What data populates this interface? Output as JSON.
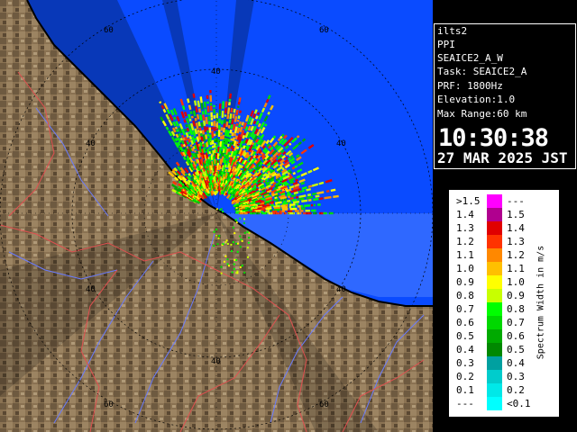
{
  "info": {
    "site": "ilts2",
    "mode": "PPI",
    "product": "SEAICE2_A_W",
    "task": "Task: SEAICE2_A",
    "prf": "PRF: 1800Hz",
    "elevation": "Elevation:1.0",
    "max_range": "Max Range:60 km",
    "time": "10:30:38",
    "date": "27 MAR 2025 JST"
  },
  "map": {
    "ring_labels": [
      "60",
      "60",
      "40",
      "40",
      "40",
      "40",
      "40",
      "40",
      "60",
      "60"
    ],
    "colors": {
      "sea": "#0a4bff",
      "sea_light": "#3a7dff",
      "land": "#8b7355",
      "shadow_sea": "#08308f"
    }
  },
  "legend": {
    "unit": "Spectrum Width in m/s",
    "rows": [
      {
        "left": ">1.5",
        "right": "---",
        "color": "#ff00ff"
      },
      {
        "left": "1.4",
        "right": "1.5",
        "color": "#b0008f"
      },
      {
        "left": "1.3",
        "right": "1.4",
        "color": "#e00000"
      },
      {
        "left": "1.2",
        "right": "1.3",
        "color": "#ff3300"
      },
      {
        "left": "1.1",
        "right": "1.2",
        "color": "#ff8800"
      },
      {
        "left": "1.0",
        "right": "1.1",
        "color": "#ffc000"
      },
      {
        "left": "0.9",
        "right": "1.0",
        "color": "#ffff00"
      },
      {
        "left": "0.8",
        "right": "0.9",
        "color": "#c8ff00"
      },
      {
        "left": "0.7",
        "right": "0.8",
        "color": "#00ff00"
      },
      {
        "left": "0.6",
        "right": "0.7",
        "color": "#00d800"
      },
      {
        "left": "0.5",
        "right": "0.6",
        "color": "#00aa00"
      },
      {
        "left": "0.4",
        "right": "0.5",
        "color": "#008800"
      },
      {
        "left": "0.3",
        "right": "0.4",
        "color": "#00a0a0"
      },
      {
        "left": "0.2",
        "right": "0.3",
        "color": "#00cccc"
      },
      {
        "left": "0.1",
        "right": "0.2",
        "color": "#00e8e8"
      },
      {
        "left": "---",
        "right": "<0.1",
        "color": "#00ffff"
      }
    ]
  }
}
